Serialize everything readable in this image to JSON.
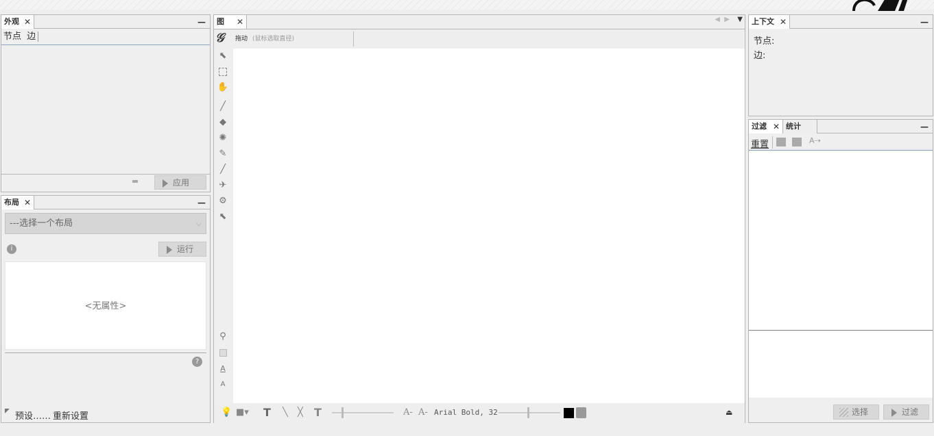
{
  "appearance": {
    "tab": "外观",
    "close": "✕",
    "minimize": "—",
    "nodes": "节点",
    "edges": "边",
    "apply": "应用"
  },
  "layout": {
    "tab": "布局",
    "close": "✕",
    "minimize": "—",
    "select": "---选择一个布局",
    "run": "运行",
    "no_props": "<无属性>",
    "presets": "预设……",
    "reset": "重新设置"
  },
  "graph": {
    "tab": "图",
    "close": "✕",
    "drag": "拖动",
    "hint": "(鼠标选取直径)",
    "font": "Arial Bold, 32"
  },
  "context": {
    "tab": "上下文",
    "close": "✕",
    "minimize": "—",
    "nodes": "节点:",
    "edges": "边:"
  },
  "filters": {
    "tab": "过滤",
    "close": "✕",
    "stats_tab": "统计",
    "minimize": "—",
    "reset": "重置",
    "select": "选择",
    "filter": "过滤"
  },
  "colors": {
    "border": "#b5b5b5",
    "canvas": "#ffffff",
    "panel": "#efefef"
  }
}
